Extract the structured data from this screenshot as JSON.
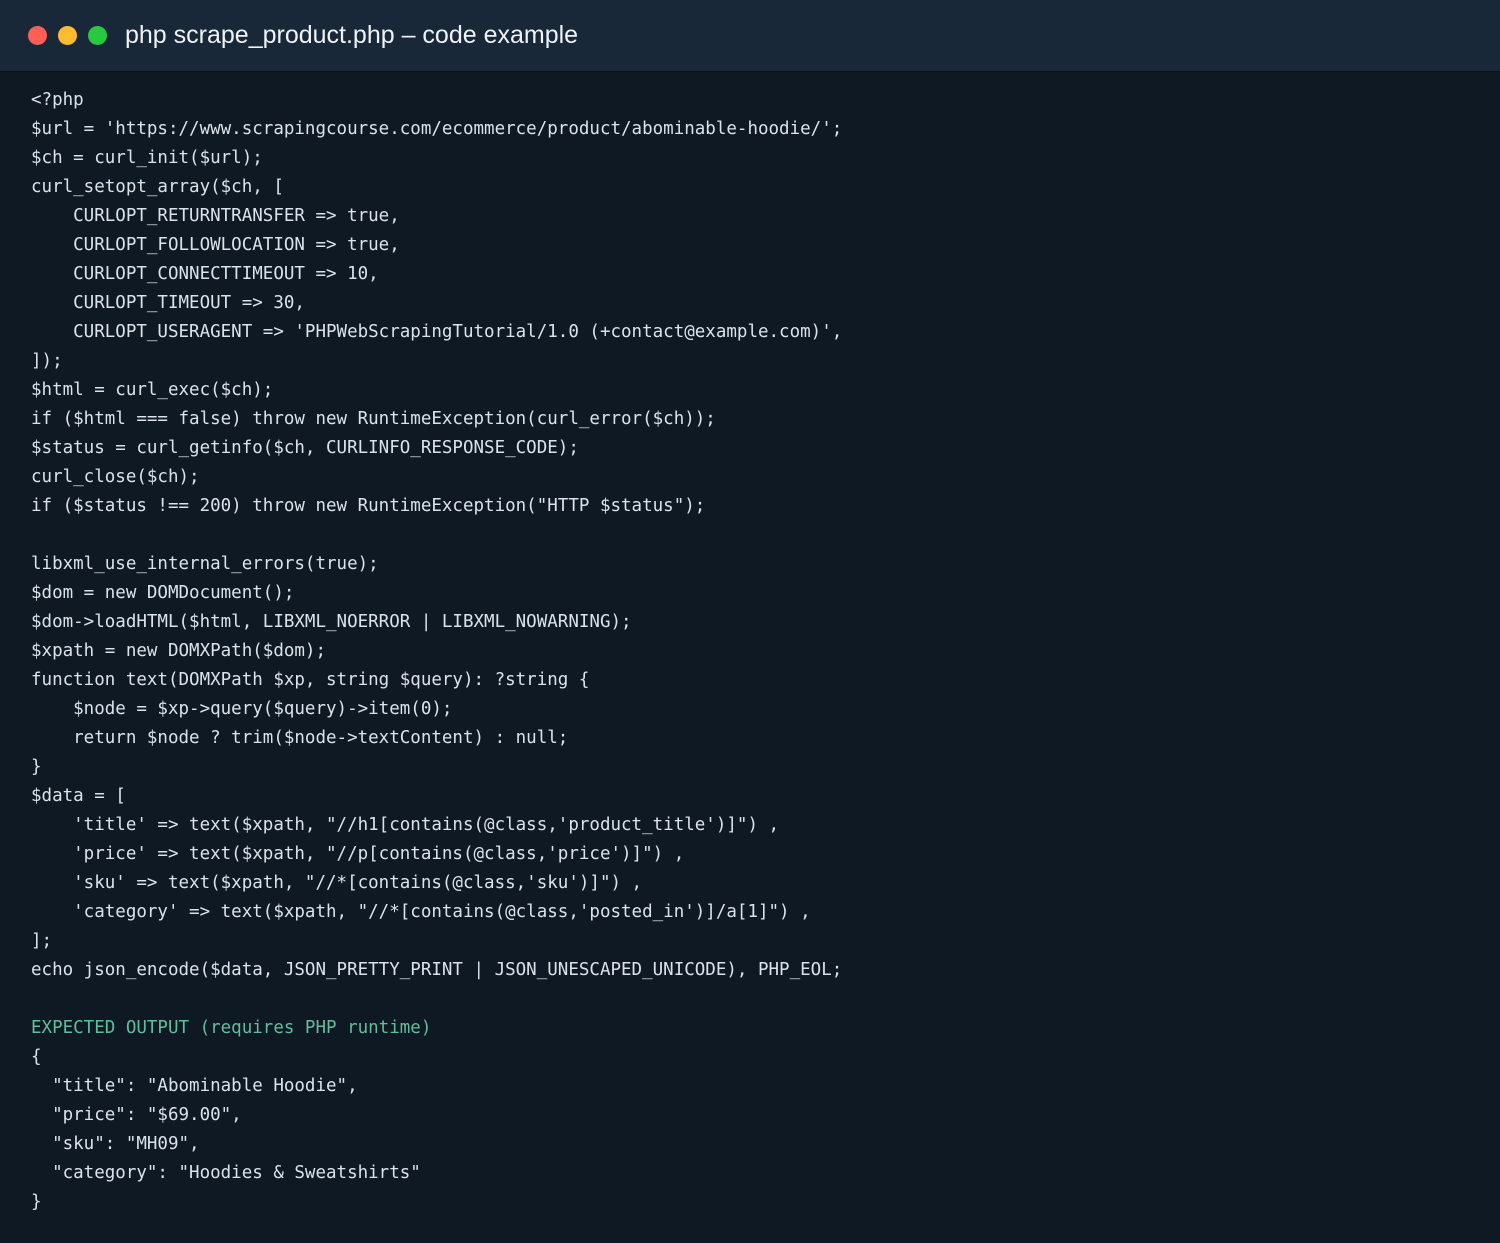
{
  "window": {
    "title": "php scrape_product.php – code example",
    "colors": {
      "close": "#ff5f57",
      "minimize": "#febc2e",
      "zoom": "#28c840",
      "background": "#0f1923",
      "titlebar": "#192838",
      "text": "#dbe2ea",
      "comment": "#5fbf9a"
    }
  },
  "code": {
    "lines": [
      "<?php",
      "$url = 'https://www.scrapingcourse.com/ecommerce/product/abominable-hoodie/';",
      "$ch = curl_init($url);",
      "curl_setopt_array($ch, [",
      "    CURLOPT_RETURNTRANSFER => true,",
      "    CURLOPT_FOLLOWLOCATION => true,",
      "    CURLOPT_CONNECTTIMEOUT => 10,",
      "    CURLOPT_TIMEOUT => 30,",
      "    CURLOPT_USERAGENT => 'PHPWebScrapingTutorial/1.0 (+contact@example.com)',",
      "]);",
      "$html = curl_exec($ch);",
      "if ($html === false) throw new RuntimeException(curl_error($ch));",
      "$status = curl_getinfo($ch, CURLINFO_RESPONSE_CODE);",
      "curl_close($ch);",
      "if ($status !== 200) throw new RuntimeException(\"HTTP $status\");",
      "",
      "libxml_use_internal_errors(true);",
      "$dom = new DOMDocument();",
      "$dom->loadHTML($html, LIBXML_NOERROR | LIBXML_NOWARNING);",
      "$xpath = new DOMXPath($dom);",
      "function text(DOMXPath $xp, string $query): ?string {",
      "    $node = $xp->query($query)->item(0);",
      "    return $node ? trim($node->textContent) : null;",
      "}",
      "$data = [",
      "    'title' => text($xpath, \"//h1[contains(@class,'product_title')]\") ,",
      "    'price' => text($xpath, \"//p[contains(@class,'price')]\") ,",
      "    'sku' => text($xpath, \"//*[contains(@class,'sku')]\") ,",
      "    'category' => text($xpath, \"//*[contains(@class,'posted_in')]/a[1]\") ,",
      "];",
      "echo json_encode($data, JSON_PRETTY_PRINT | JSON_UNESCAPED_UNICODE), PHP_EOL;",
      "",
      "EXPECTED OUTPUT (requires PHP runtime)",
      "{",
      "  \"title\": \"Abominable Hoodie\",",
      "  \"price\": \"$69.00\",",
      "  \"sku\": \"MH09\",",
      "  \"category\": \"Hoodies & Sweatshirts\"",
      "}"
    ]
  }
}
